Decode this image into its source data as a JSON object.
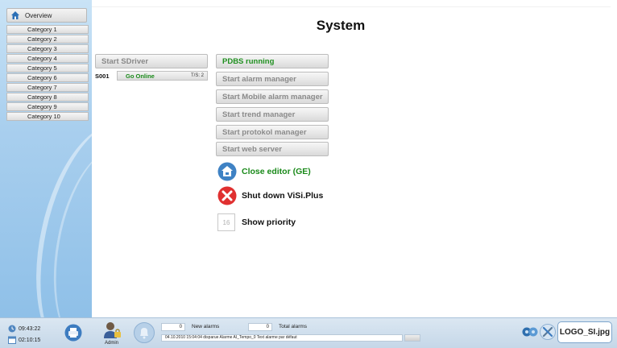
{
  "sidebar": {
    "overview_label": "Overview",
    "items": [
      "Category 1",
      "Category 2",
      "Category 3",
      "Category 4",
      "Category 5",
      "Category 6",
      "Category 7",
      "Category 8",
      "Category 9",
      "Category 10"
    ]
  },
  "header": {
    "title": "System"
  },
  "driver": {
    "start_label": "Start SDriver",
    "id": "S001",
    "action_label": "Go Online",
    "ts_label": "T/S: 2"
  },
  "managers": {
    "pdbs": "PDBS running",
    "alarm": "Start alarm manager",
    "mobile_alarm": "Start Mobile alarm manager",
    "trend": "Start trend manager",
    "protokol": "Start protokol manager",
    "web": "Start web server"
  },
  "actions": {
    "close_editor": "Close editor (GE)",
    "shutdown": "Shut down ViSi.Plus",
    "priority_value": "16",
    "priority_label": "Show priority"
  },
  "statusbar": {
    "time": "09:43:22",
    "runtime": "02:10:15",
    "user": "Admin",
    "new_alarms_count": "0",
    "new_alarms_label": "New alarms",
    "total_alarms_count": "0",
    "total_alarms_label": "Total alarms",
    "alarm_message": "04.10.2010 15:04:04 disparue Alarme AI_Tempo_0 Text alarme par défaut",
    "logo_text": "LOGO_SI.jpg"
  },
  "colors": {
    "accent_green": "#1f8f1f",
    "sidebar_blue": "#a9cfee",
    "shutdown_red": "#e03030"
  }
}
